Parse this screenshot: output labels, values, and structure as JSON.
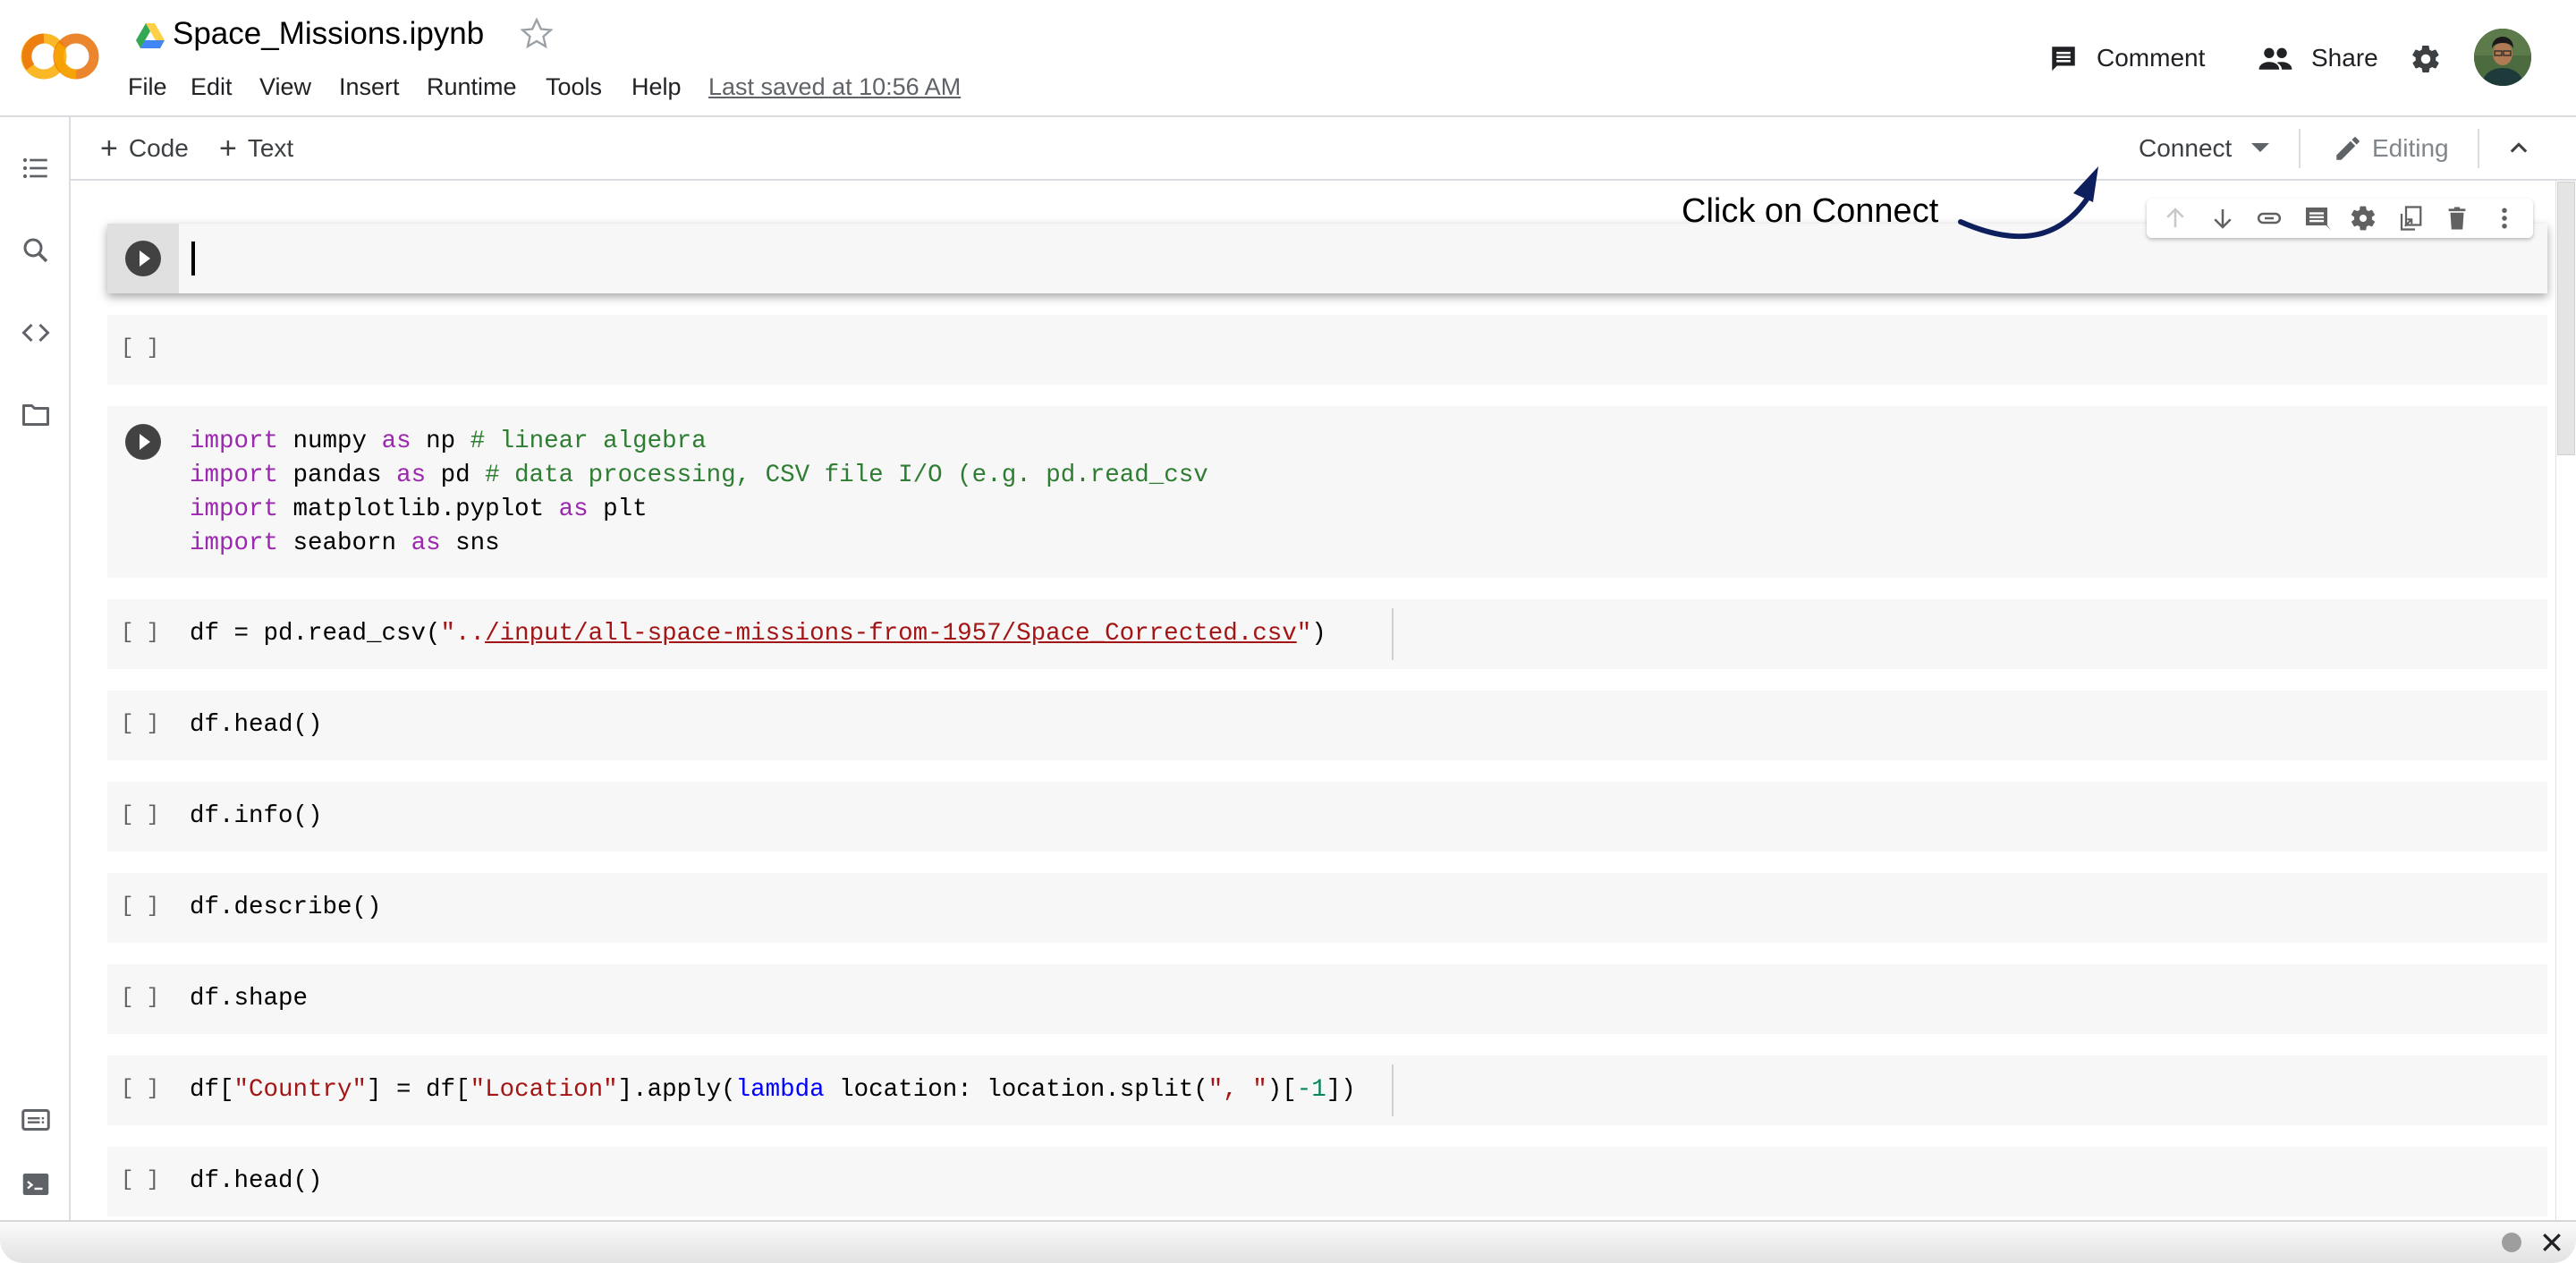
{
  "header": {
    "title": "Space_Missions.ipynb",
    "menu": [
      "File",
      "Edit",
      "View",
      "Insert",
      "Runtime",
      "Tools",
      "Help"
    ],
    "last_saved": "Last saved at 10:56 AM",
    "comment_label": "Comment",
    "share_label": "Share",
    "icons": {
      "logo": "colab-logo",
      "drive": "google-drive-icon",
      "star": "star-outline-icon",
      "comment": "comment-icon",
      "share": "people-icon",
      "settings": "gear-icon",
      "avatar": "user-avatar"
    }
  },
  "sidebar": {
    "items": [
      {
        "name": "table-of-contents",
        "icon": "list-icon"
      },
      {
        "name": "find-replace",
        "icon": "search-icon"
      },
      {
        "name": "code-snippets",
        "icon": "code-icon"
      },
      {
        "name": "files",
        "icon": "folder-icon"
      },
      {
        "name": "command-palette",
        "icon": "keyboard-icon"
      },
      {
        "name": "terminal",
        "icon": "terminal-icon"
      }
    ]
  },
  "toolbar": {
    "add_code": "Code",
    "add_text": "Text",
    "connect": "Connect",
    "editing": "Editing"
  },
  "cell_toolbar": {
    "icons": [
      "arrow-up-icon",
      "arrow-down-icon",
      "link-icon",
      "comment-icon",
      "gear-icon",
      "mirror-cell-icon",
      "delete-icon",
      "more-vert-icon"
    ]
  },
  "annotation": {
    "text": "Click on Connect",
    "color": "#0d1f5c"
  },
  "cells": [
    {
      "type": "code",
      "state": "active",
      "execution_count": "",
      "lines": [
        ""
      ]
    },
    {
      "type": "code",
      "state": "idle",
      "execution_count": "[ ]",
      "lines": [
        ""
      ]
    },
    {
      "type": "code",
      "state": "hover",
      "execution_count": "",
      "lines": [
        "import numpy as np # linear algebra",
        "import pandas as pd # data processing, CSV file I/O (e.g. pd.read_csv",
        "import matplotlib.pyplot as plt",
        "import seaborn as sns"
      ]
    },
    {
      "type": "code",
      "state": "idle",
      "execution_count": "[ ]",
      "lines": [
        "df = pd.read_csv(\"../input/all-space-missions-from-1957/Space_Corrected.csv\")"
      ]
    },
    {
      "type": "code",
      "state": "idle",
      "execution_count": "[ ]",
      "lines": [
        "df.head()"
      ]
    },
    {
      "type": "code",
      "state": "idle",
      "execution_count": "[ ]",
      "lines": [
        "df.info()"
      ]
    },
    {
      "type": "code",
      "state": "idle",
      "execution_count": "[ ]",
      "lines": [
        "df.describe()"
      ]
    },
    {
      "type": "code",
      "state": "idle",
      "execution_count": "[ ]",
      "lines": [
        "df.shape"
      ]
    },
    {
      "type": "code",
      "state": "idle",
      "execution_count": "[ ]",
      "lines": [
        "df[\"Country\"] = df[\"Location\"].apply(lambda location: location.split(\", \")[-1])"
      ]
    },
    {
      "type": "code",
      "state": "idle",
      "execution_count": "[ ]",
      "lines": [
        "df.head()"
      ]
    }
  ],
  "code_tokens": {
    "import_kw": "import",
    "as_kw": "as",
    "numpy": " numpy ",
    "np": " np ",
    "cm1": "# linear algebra",
    "pandas": " pandas ",
    "pd": " pd ",
    "cm2": "# data processing, CSV file I/O (e.g. pd.read_csv",
    "matplotlib": " matplotlib.pyplot ",
    "plt": " plt",
    "seaborn": " seaborn ",
    "sns": " sns",
    "rc_pre": "df = pd.read_csv(",
    "rc_q1": "\"..",
    "rc_path": "/input/all-space-missions-from-1957/Space_Corrected.csv",
    "rc_q2": "\"",
    "rc_post": ")",
    "head": "df.head()",
    "info": "df.info()",
    "describe": "df.describe()",
    "shape": "df.shape",
    "c_pre1": "df[",
    "c_country": "\"Country\"",
    "c_mid1": "] = df[",
    "c_location": "\"Location\"",
    "c_mid2": "].apply(",
    "c_lambda": "lambda",
    "c_mid3": " location: location.split(",
    "c_sep": "\", \"",
    "c_mid4": ")[",
    "c_num": "-1",
    "c_end": "])",
    "bracket": "[ ]"
  },
  "status": {
    "indicator": "status-dot",
    "close": "close-icon"
  },
  "colors": {
    "accent_orange": "#f9ab00",
    "keyword": "#9c27b0",
    "comment": "#2e7d32",
    "string": "#a31515",
    "lambda": "#0000ff",
    "number": "#098658"
  }
}
